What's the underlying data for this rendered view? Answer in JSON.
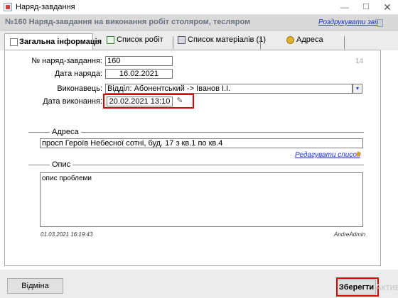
{
  "window": {
    "title": "Наряд-завдання",
    "minimize_glyph": "—",
    "maximize_glyph": "☐",
    "close_glyph": "✕"
  },
  "header": {
    "title": "№160 Наряд-завдання на виконання робіт столяром, тесляром",
    "print_link": "Роздрукувати звіт"
  },
  "tabs": [
    {
      "label": "Загальна інформація",
      "icon": "document-icon",
      "active": true
    },
    {
      "label": "Список робіт",
      "icon": "list-icon",
      "active": false
    },
    {
      "label": "Список матеріалів (1)",
      "icon": "materials-icon",
      "active": false
    },
    {
      "label": "Адреса",
      "icon": "pin-icon",
      "active": false
    }
  ],
  "form": {
    "order_number_label": "№ наряд-завдання:",
    "order_number_value": "160",
    "side_number": "14",
    "order_date_label": "Дата наряда:",
    "order_date_value": "16.02.2021",
    "executor_label": "Виконавець:",
    "executor_value": "Відділ: Абонентський -> Іванов І.І.",
    "execution_date_label": "Дата виконання:",
    "execution_date_value": "20.02.2021 13:10"
  },
  "address_section": {
    "title": "Адреса",
    "value": "просп Героїв Небесної сотні, буд. 17 з кв.1 по кв.4",
    "edit_link": "Редагувати список"
  },
  "description_section": {
    "title": "Опис",
    "value": "опис проблеми"
  },
  "meta": {
    "timestamp": "01.03.2021 16:19:43",
    "author": "AndreAdmin"
  },
  "footer": {
    "cancel_label": "Відміна",
    "save_label": "Зберегти",
    "watermark": "Активац"
  },
  "colors": {
    "highlight": "#e00000",
    "link": "#1a35c8"
  }
}
